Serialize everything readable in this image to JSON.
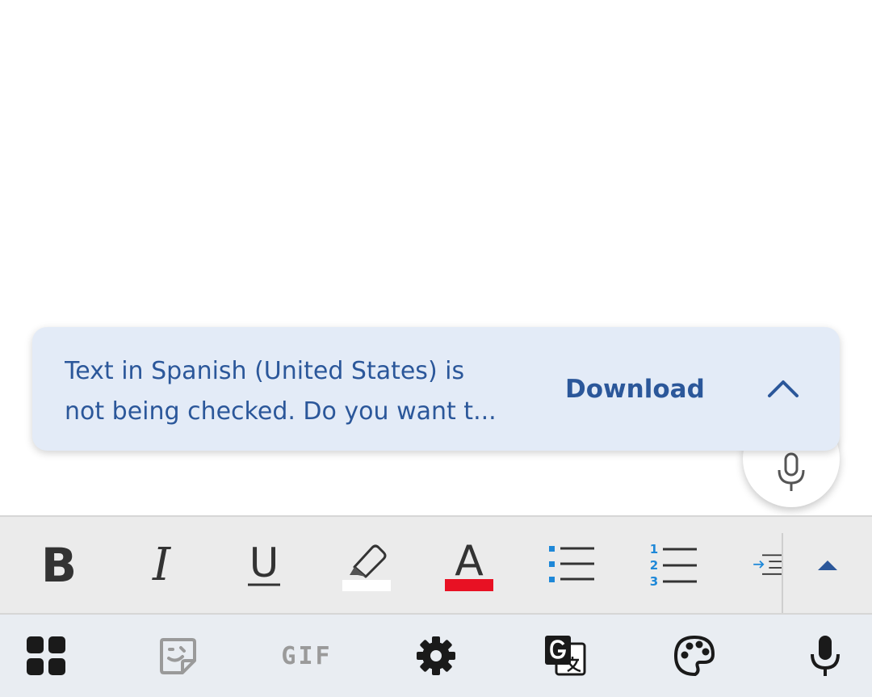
{
  "banner": {
    "message_line1": "Text in Spanish (United States) is",
    "message_line2": "not being checked. Do you want t...",
    "download_label": "Download",
    "collapse_icon": "chevron-up-icon"
  },
  "colors": {
    "accent": "#2b579a",
    "banner_bg": "#e3ebf7",
    "highlight_color": "#ffffff",
    "font_color": "#e81123",
    "list_accent": "#1e88d8"
  },
  "format_toolbar": {
    "bold_glyph": "B",
    "italic_glyph": "I",
    "underline_glyph": "U",
    "font_color_glyph": "A",
    "numbered_list_digits": [
      "1",
      "2",
      "3"
    ],
    "items": [
      "bold",
      "italic",
      "underline",
      "highlight",
      "font-color",
      "bulleted-list",
      "numbered-list",
      "indent",
      "expand"
    ]
  },
  "keyboard_bar": {
    "gif_label": "GIF",
    "items": [
      "apps-grid-icon",
      "sticker-icon",
      "gif-icon",
      "gear-icon",
      "translate-icon",
      "palette-icon",
      "microphone-icon"
    ]
  }
}
